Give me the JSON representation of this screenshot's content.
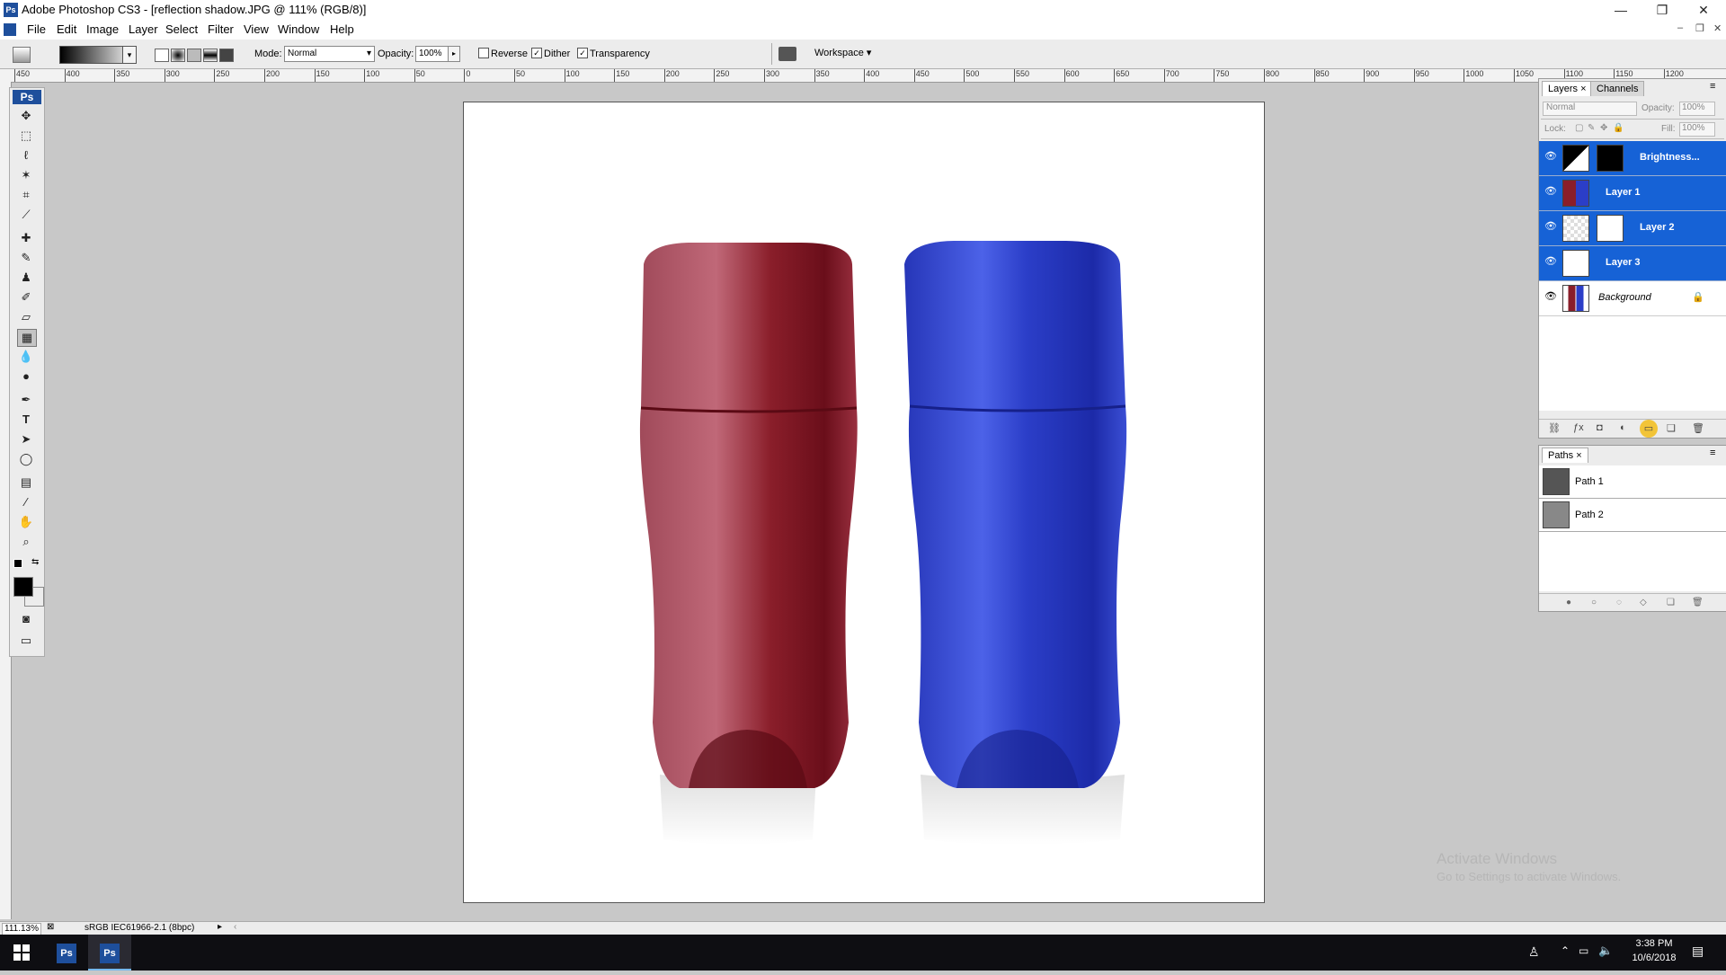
{
  "window": {
    "app_badge": "Ps",
    "title": "Adobe Photoshop CS3 - [reflection shadow.JPG @ 111% (RGB/8)]",
    "controls": {
      "minimize": "—",
      "restore": "❐",
      "close": "✕"
    },
    "doc_controls": {
      "minimize": "–",
      "restore": "❐",
      "close": "✕"
    }
  },
  "menu": {
    "items": [
      "File",
      "Edit",
      "Image",
      "Layer",
      "Select",
      "Filter",
      "View",
      "Window",
      "Help"
    ]
  },
  "options": {
    "gradient_dropdown": "▾",
    "mode_label": "Mode:",
    "mode_value": "Normal",
    "opacity_label": "Opacity:",
    "opacity_value": "100%",
    "reverse_label": "Reverse",
    "reverse_checked": false,
    "dither_label": "Dither",
    "dither_checked": true,
    "transparency_label": "Transparency",
    "transparency_checked": true,
    "workspace_label": "Workspace"
  },
  "ruler": {
    "h_labels": [
      "450",
      "400",
      "350",
      "300",
      "250",
      "200",
      "150",
      "100",
      "50",
      "0",
      "50",
      "100",
      "150",
      "200",
      "250",
      "300",
      "350",
      "400",
      "450",
      "500",
      "550",
      "600",
      "650",
      "700",
      "750",
      "800",
      "850",
      "900",
      "950",
      "1000",
      "1050",
      "1100",
      "1150",
      "1200"
    ]
  },
  "toolbox": {
    "badge": "Ps",
    "tools": [
      "move-tool",
      "marquee-tool",
      "lasso-tool",
      "magic-wand-tool",
      "crop-tool",
      "eyedropper-tool",
      "healing-tool",
      "brush-tool",
      "clone-stamp-tool",
      "history-brush-tool",
      "eraser-tool",
      "gradient-tool",
      "blur-tool",
      "dodge-tool",
      "pen-tool",
      "type-tool",
      "path-selection-tool",
      "shape-tool",
      "notes-tool",
      "eyedropper2-tool",
      "hand-tool",
      "zoom-tool"
    ],
    "foreground_color": "#000000",
    "background_color": "#ffffff"
  },
  "layers_panel": {
    "tabs": [
      "Layers",
      "Channels"
    ],
    "blend_mode": "Normal",
    "opacity_label": "Opacity:",
    "opacity_value": "100%",
    "lock_label": "Lock:",
    "fill_label": "Fill:",
    "fill_value": "100%",
    "layers": [
      {
        "name": "Brightness...",
        "selected": true,
        "has_mask": true,
        "locked": false
      },
      {
        "name": "Layer 1",
        "selected": true,
        "has_mask": false,
        "locked": false
      },
      {
        "name": "Layer 2",
        "selected": true,
        "has_mask": true,
        "locked": false
      },
      {
        "name": "Layer 3",
        "selected": true,
        "has_mask": false,
        "locked": false
      },
      {
        "name": "Background",
        "selected": false,
        "has_mask": false,
        "locked": true
      }
    ]
  },
  "paths_panel": {
    "tabs": [
      "Paths"
    ],
    "paths": [
      "Path 1",
      "Path 2"
    ]
  },
  "status": {
    "zoom": "111.13%",
    "profile": "sRGB IEC61966-2.1 (8bpc)"
  },
  "watermark": {
    "line1": "Activate Windows",
    "line2": "Go to Settings to activate Windows."
  },
  "taskbar": {
    "time": "3:38 PM",
    "date": "10/6/2018",
    "apps": [
      "Ps",
      "Ps"
    ]
  },
  "colors": {
    "selection_blue": "#1662d6",
    "ps_blue": "#1e4f9c",
    "bottle_red": "#8a1e2a",
    "bottle_blue": "#2b3ec8"
  }
}
